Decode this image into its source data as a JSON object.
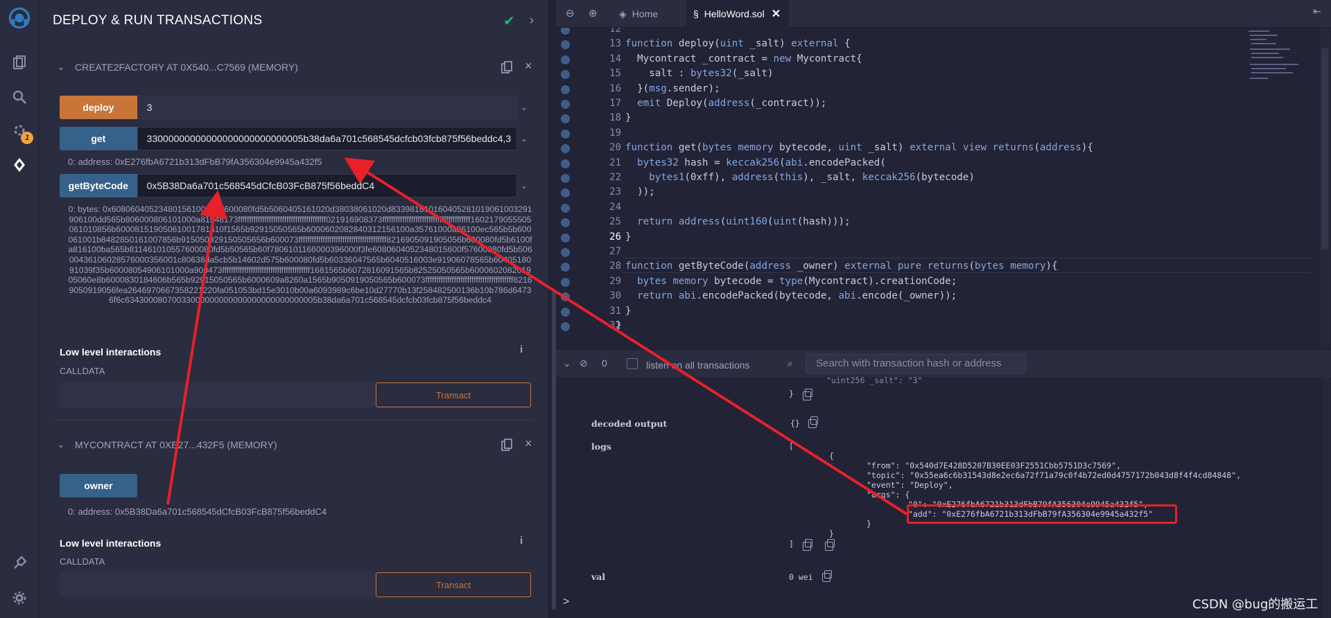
{
  "icon_panel": {
    "badge_count": "1",
    "icons": [
      "remix-logo-icon",
      "file-explorer-icon",
      "search-icon",
      "compiler-icon",
      "deploy-icon",
      "plugin-manager-icon",
      "settings-icon"
    ]
  },
  "panel": {
    "title": "DEPLOY & RUN TRANSACTIONS",
    "instance1": {
      "name": "CREATE2FACTORY AT 0X540...C7569 (MEMORY)",
      "functions": [
        {
          "label": "deploy",
          "value": "3"
        },
        {
          "label": "get",
          "value": "33000000000000000000000000005b38da6a701c568545dcfcb03fcb875f56beddc4,3"
        },
        {
          "label": "getByteCode",
          "value": "0x5B38Da6a701c568545dCfcB03FcB875f56beddC4"
        }
      ],
      "get_output": "0: address: 0xE276fbA6721b313dFbB79fA356304e9945a432f5",
      "bytecode_output": "0: bytes: 0x608060405234801561001057600080fd5b5060405161020d38038061020d833981810160405281019061003291906100dd565b806000806101000a81548173ffffffffffffffffffffffffffffffffffffffff021916908373ffffffffffffffffffffffffffffffffffffffff1602179055505061010856b60008151905061001781610f1565b92915050565b6000602082840312156100a35761000a26100ec565b5b600061001b8482850161007856b915050929150505656b600073ffffffffffffffffffffffffffffffffffffffff8216905091905056b600080fd5b6100fa816100ba565b811461010557600080fd5b50565b60f7806101166000396000f3fe6080604052348015600f57600080fd5b50600436106028576000356001c80638da5cb5b14602d575b600080fd5b60336047565b6040516003e91906078565b6040518091039f35b60008054906101000a900473ffffffffffffffffffffffffffffffffffffffff1681565b6072816091565b82525050565b600060208201905060e8b6000830184606b565b92915050565b6000609a8260a1565b9050919050565b600073ffffffffffffffffffffffffffffffffffffffff82169050919056fea2646970667358221220fa051053bd15e3010b00a6093989c6be10d27770b13f258482500136b10b786d64736f6c63430008070033000000000000000000000000005b38da6a701c568545dcfcb03fcb875f56beddc4",
      "low_level": "Low level interactions",
      "calldata": "CALLDATA",
      "transact": "Transact"
    },
    "instance2": {
      "name": "MYCONTRACT AT 0XE27...432F5 (MEMORY)",
      "functions": [
        {
          "label": "owner"
        }
      ],
      "owner_output": "0: address: 0x5B38Da6a701c568545dCfcB03FcB875f56beddC4",
      "low_level": "Low level interactions",
      "calldata": "CALLDATA",
      "transact": "Transact"
    }
  },
  "editor": {
    "tabs": [
      {
        "label": "Home"
      },
      {
        "label": "HelloWord.sol"
      }
    ],
    "current_line": "26",
    "lines": [
      {
        "n": "12",
        "text": ""
      },
      {
        "n": "13",
        "text": "function deploy(uint _salt) external {"
      },
      {
        "n": "14",
        "text": "  Mycontract _contract = new Mycontract{"
      },
      {
        "n": "15",
        "text": "    salt : bytes32(_salt)"
      },
      {
        "n": "16",
        "text": "  }(msg.sender);"
      },
      {
        "n": "17",
        "text": "  emit Deploy(address(_contract));"
      },
      {
        "n": "18",
        "text": "}"
      },
      {
        "n": "19",
        "text": ""
      },
      {
        "n": "20",
        "text": "function get(bytes memory bytecode, uint _salt) external view returns(address){"
      },
      {
        "n": "21",
        "text": "  bytes32 hash = keccak256(abi.encodePacked("
      },
      {
        "n": "22",
        "text": "    bytes1(0xff), address(this), _salt, keccak256(bytecode)"
      },
      {
        "n": "23",
        "text": "  ));"
      },
      {
        "n": "24",
        "text": ""
      },
      {
        "n": "25",
        "text": "  return address(uint160(uint(hash)));"
      },
      {
        "n": "26",
        "text": "}"
      },
      {
        "n": "27",
        "text": ""
      },
      {
        "n": "28",
        "text": "function getByteCode(address _owner) external pure returns(bytes memory){"
      },
      {
        "n": "29",
        "text": "  bytes memory bytecode = type(Mycontract).creationCode;"
      },
      {
        "n": "30",
        "text": "  return abi.encodePacked(bytecode, abi.encode(_owner));"
      },
      {
        "n": "31",
        "text": "}"
      },
      {
        "n": "32",
        "text": "}"
      }
    ]
  },
  "terminal": {
    "count": "0",
    "listen_label": "listen on all transactions",
    "search_placeholder": "Search with transaction hash or address",
    "salt_line": "\"uint256 _salt\": \"3\"",
    "decoded_output_label": "decoded output",
    "decoded_output_value": "{}",
    "logs_label": "logs",
    "log_from": "\"from\": \"0x540d7E428D5207B30EE03F2551Cbb5751D3c7569\",",
    "log_topic": "\"topic\": \"0x55ea6c6b31543d8e2ec6a72f71a79c0f4b72ed0d4757172b043d8f4f4cd84848\",",
    "log_event": "\"event\": \"Deploy\",",
    "log_args": "\"args\": {",
    "log_arg0": "\"0\": \"0xE276fbA6721b313dFbB79fA356304e9945a432f5\",",
    "log_add": "\"add\": \"0xE276fbA6721b313dFbB79fA356304e9945a432f5\"",
    "val_label": "val",
    "val_value": "0 wei",
    "prompt": ">"
  },
  "watermark": "CSDN @bug的搬运工",
  "colors": {
    "accent_orange": "#c97539",
    "accent_blue": "#35618a",
    "highlight_red": "#e8202a",
    "success_green": "#1ab77b"
  }
}
